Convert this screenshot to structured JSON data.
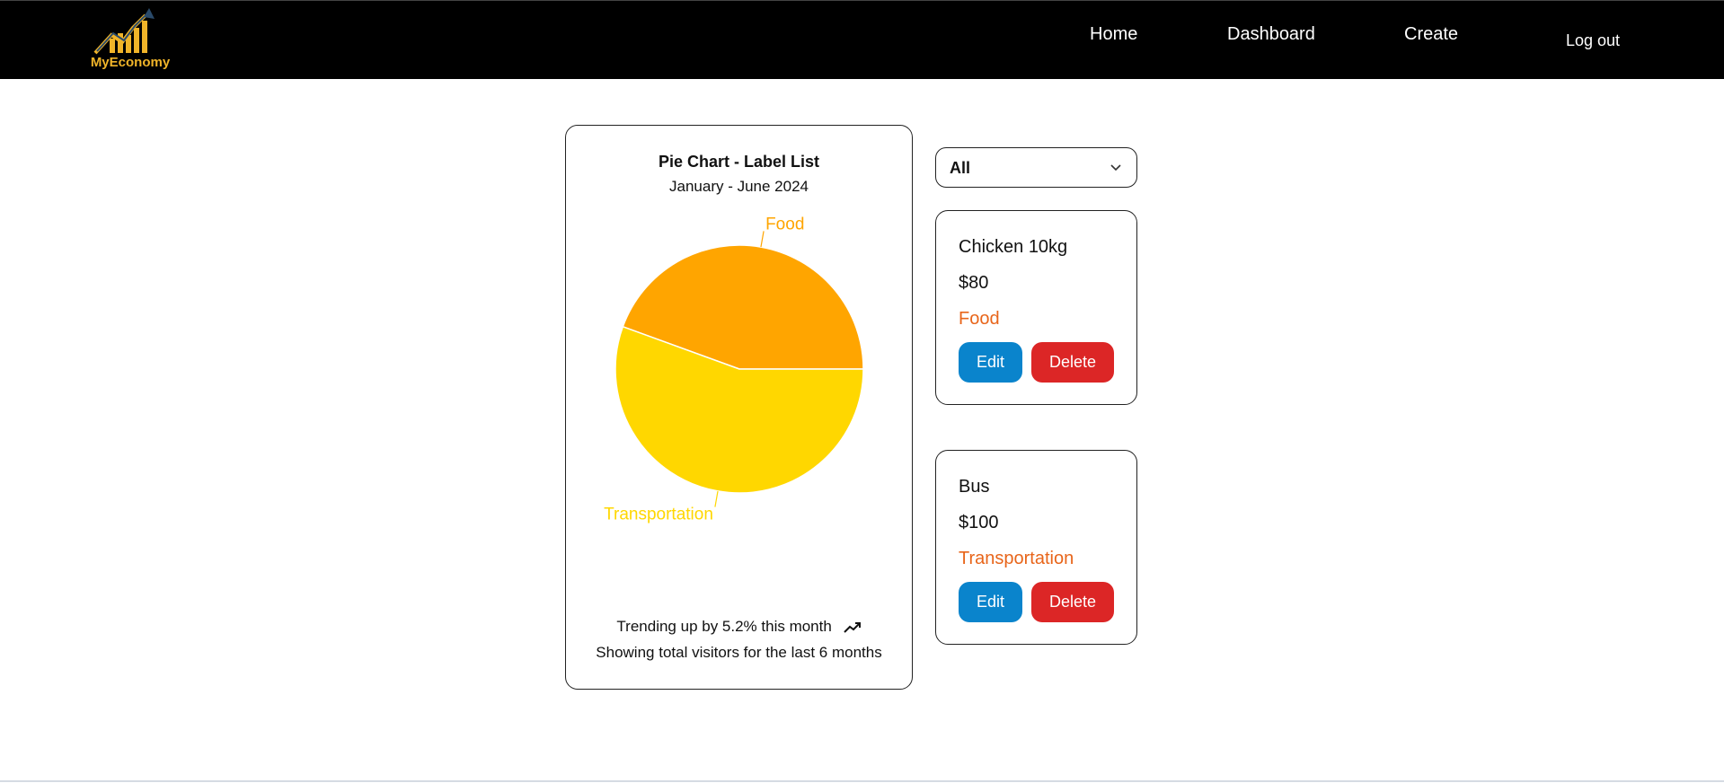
{
  "app": {
    "logo_text": "MyEconomy"
  },
  "nav": {
    "home": "Home",
    "dashboard": "Dashboard",
    "create": "Create",
    "logout": "Log out"
  },
  "chart_card": {
    "footer_trend": "Trending up by 5.2% this month",
    "footer_note": "Showing total visitors for the last 6 months"
  },
  "chart_data": {
    "type": "pie",
    "title": "Pie Chart - Label List",
    "subtitle": "January - June 2024",
    "slices": [
      {
        "label": "Food",
        "value": 80,
        "color": "#FFA500"
      },
      {
        "label": "Transportation",
        "value": 100,
        "color": "#FFD700"
      }
    ],
    "legend": "labels-outside"
  },
  "filter": {
    "selected": "All"
  },
  "items": [
    {
      "name": "Chicken 10kg",
      "price": "$80",
      "category": "Food",
      "edit_label": "Edit",
      "delete_label": "Delete"
    },
    {
      "name": "Bus",
      "price": "$100",
      "category": "Transportation",
      "edit_label": "Edit",
      "delete_label": "Delete"
    }
  ],
  "colors": {
    "category_text": "#e8651a",
    "edit_button": "#0a84cc",
    "delete_button": "#dc2626",
    "logo_gold": "#f0b429"
  }
}
